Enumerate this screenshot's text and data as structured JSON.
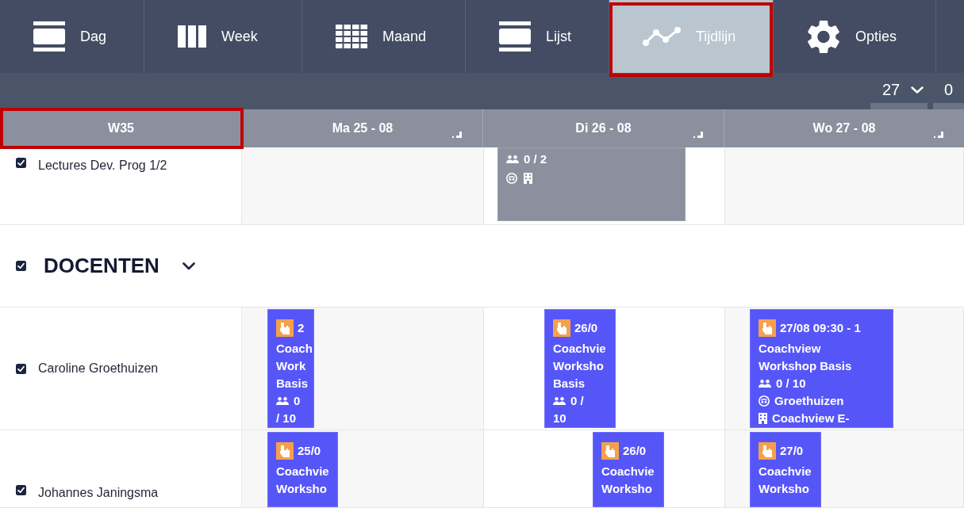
{
  "toolbar": {
    "tabs": [
      {
        "kind": "day",
        "label": "Dag",
        "selected": false,
        "highlighted": false
      },
      {
        "kind": "week",
        "label": "Week",
        "selected": false,
        "highlighted": false
      },
      {
        "kind": "month",
        "label": "Maand",
        "selected": false,
        "highlighted": false
      },
      {
        "kind": "list",
        "label": "Lijst",
        "selected": false,
        "highlighted": false
      },
      {
        "kind": "timeline",
        "label": "Tijdlijn",
        "selected": true,
        "highlighted": true
      },
      {
        "kind": "settings",
        "label": "Opties",
        "selected": false,
        "highlighted": false
      }
    ]
  },
  "date_bar": {
    "day_select": {
      "value": "27"
    },
    "month_select": {
      "value": "0"
    }
  },
  "grid": {
    "header": {
      "week": {
        "label": "W35",
        "highlighted": true
      },
      "days": [
        {
          "label": "Ma 25 - 08"
        },
        {
          "label": "Di 26 - 08"
        },
        {
          "label": "Wo 27 - 08"
        }
      ]
    },
    "rows": [
      {
        "kind": "resource",
        "label": "Lectures Dev. Prog 1/2",
        "checked": true,
        "cells": [
          {},
          {
            "events": [
              {
                "color": "#8a909e",
                "lines": [
                  {
                    "kind": "participants",
                    "text": "0 / 2"
                  },
                  {
                    "kind": "markers"
                  }
                ]
              }
            ]
          },
          {}
        ]
      },
      {
        "kind": "group",
        "label": "DOCENTEN",
        "checked": true,
        "expanded": true
      },
      {
        "kind": "resource",
        "label": "Caroline Groethuizen",
        "checked": true,
        "cells": [
          {
            "events": [
              {
                "color": "#5656f8",
                "lines": [
                  {
                    "kind": "date",
                    "text": "2"
                  },
                  {
                    "kind": "text",
                    "text": "Coach"
                  },
                  {
                    "kind": "text",
                    "text": "Work"
                  },
                  {
                    "kind": "text",
                    "text": "Basis"
                  },
                  {
                    "kind": "participants",
                    "text": "0"
                  },
                  {
                    "kind": "text",
                    "text": "/ 10"
                  }
                ]
              }
            ]
          },
          {
            "events": [
              {
                "color": "#5656f8",
                "lines": [
                  {
                    "kind": "date",
                    "text": "26/0"
                  },
                  {
                    "kind": "text",
                    "text": "Coachvie"
                  },
                  {
                    "kind": "text",
                    "text": "Worksho"
                  },
                  {
                    "kind": "text",
                    "text": "Basis"
                  },
                  {
                    "kind": "participants",
                    "text": "0 /"
                  },
                  {
                    "kind": "text",
                    "text": "10"
                  }
                ]
              }
            ]
          },
          {
            "events": [
              {
                "color": "#5656f8",
                "lines": [
                  {
                    "kind": "date",
                    "text": "27/08 09:30 - 1"
                  },
                  {
                    "kind": "text",
                    "text": "Coachview"
                  },
                  {
                    "kind": "text",
                    "text": "Workshop Basis"
                  },
                  {
                    "kind": "participants",
                    "text": "0 / 10"
                  },
                  {
                    "kind": "teacher",
                    "text": "Groethuizen"
                  },
                  {
                    "kind": "location",
                    "text": "Coachview E-"
                  }
                ]
              }
            ]
          }
        ]
      },
      {
        "kind": "resource",
        "label": "Johannes Janingsma",
        "checked": true,
        "cells": [
          {
            "events": [
              {
                "color": "#5656f8",
                "lines": [
                  {
                    "kind": "date",
                    "text": "25/0"
                  },
                  {
                    "kind": "text",
                    "text": "Coachvie"
                  },
                  {
                    "kind": "text",
                    "text": "Worksho"
                  }
                ]
              }
            ]
          },
          {
            "events": [
              {
                "color": "#5656f8",
                "lines": [
                  {
                    "kind": "date",
                    "text": "26/0"
                  },
                  {
                    "kind": "text",
                    "text": "Coachvie"
                  },
                  {
                    "kind": "text",
                    "text": "Worksho"
                  }
                ]
              }
            ]
          },
          {
            "events": [
              {
                "color": "#5656f8",
                "lines": [
                  {
                    "kind": "date",
                    "text": "27/0"
                  },
                  {
                    "kind": "text",
                    "text": "Coachvie"
                  },
                  {
                    "kind": "text",
                    "text": "Worksho"
                  }
                ]
              }
            ]
          }
        ]
      }
    ]
  }
}
